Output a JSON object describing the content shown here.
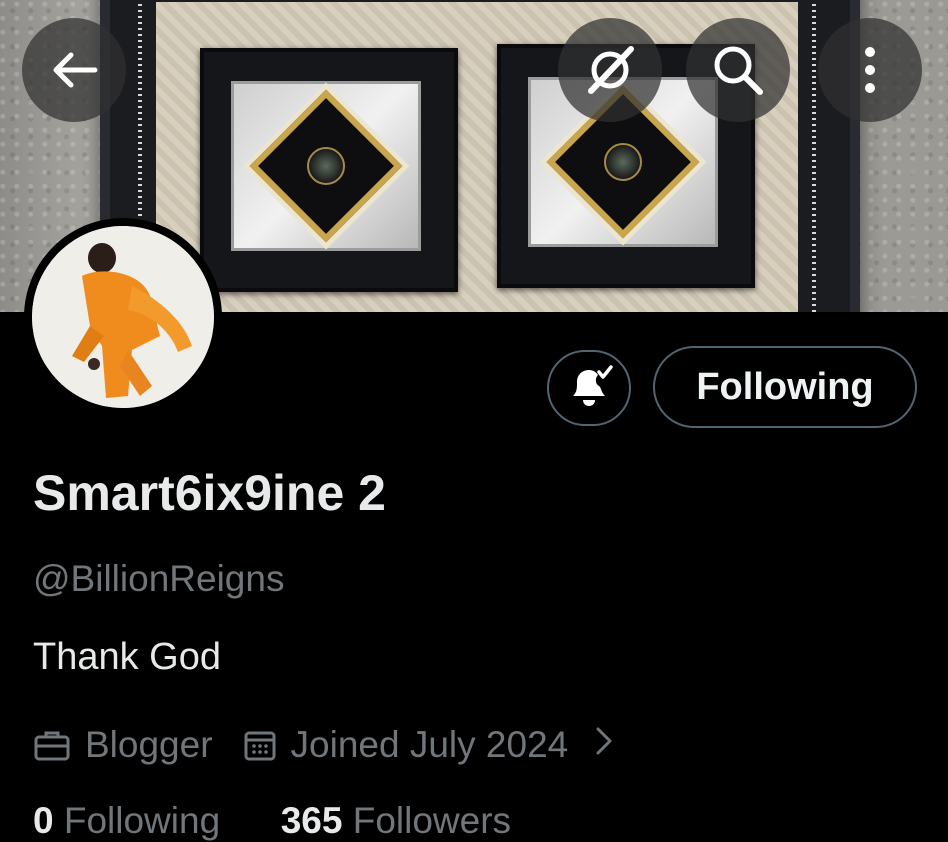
{
  "header": {
    "back_icon": "arrow-left-icon",
    "grok_icon": "grok-icon",
    "search_icon": "search-icon",
    "more_icon": "more-vertical-icon"
  },
  "profile": {
    "display_name": "Smart6ix9ine 2",
    "handle": "@BillionReigns",
    "bio": "Thank God",
    "category": "Blogger",
    "joined": "Joined July 2024",
    "following_count": "0",
    "following_label": "Following",
    "followers_count": "365",
    "followers_label": "Followers"
  },
  "actions": {
    "notify_icon": "bell-check-icon",
    "follow_button_label": "Following"
  },
  "colors": {
    "background": "#000000",
    "primary_text": "#e7e9ea",
    "secondary_text": "#71767b",
    "button_border": "#536471"
  }
}
